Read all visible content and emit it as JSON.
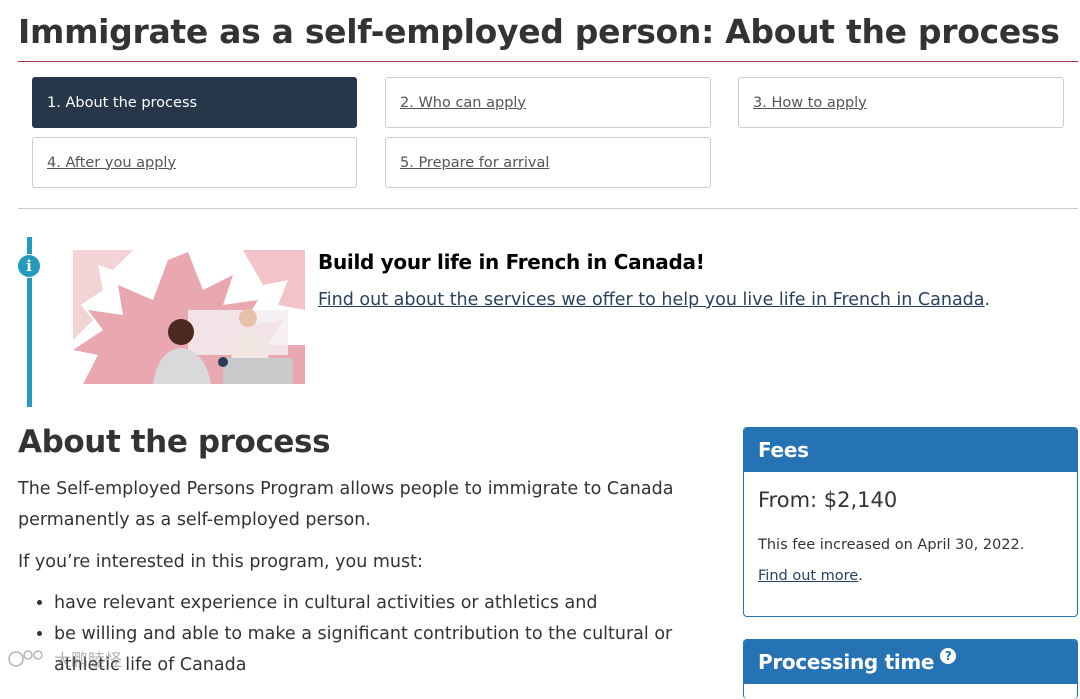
{
  "page": {
    "title": "Immigrate as a self-employed person: About the process"
  },
  "steps": [
    {
      "label": "1. About the process",
      "active": true
    },
    {
      "label": "2. Who can apply",
      "active": false
    },
    {
      "label": "3. How to apply",
      "active": false
    },
    {
      "label": "4. After you apply",
      "active": false
    },
    {
      "label": "5. Prepare for arrival",
      "active": false
    }
  ],
  "notice": {
    "icon": "info-icon",
    "title": "Build your life in French in Canada!",
    "link_text": "Find out about the services we offer to help you live life in French in Canada",
    "link_suffix": "."
  },
  "main": {
    "heading": "About the process",
    "intro": "The Self-employed Persons Program allows people to immigrate to Canada permanently as a self-employed person.",
    "requirements_lead": "If you’re interested in this program, you must:",
    "requirements": [
      "have relevant experience in cultural activities or athletics and",
      "be willing and able to make a significant contribution to the cultural or athletic life of Canada"
    ]
  },
  "fees": {
    "heading": "Fees",
    "amount": "From: $2,140",
    "note": "This fee increased on April 30, 2022.",
    "link_text": "Find out more",
    "link_suffix": "."
  },
  "processing": {
    "heading": "Processing time",
    "help_icon": "question-circle-icon"
  },
  "watermark": {
    "text": "大鹏睦怪"
  },
  "colors": {
    "active_step": "#26374a",
    "title_rule": "#af3c43",
    "panel_blue": "#2572b4",
    "info_blue": "#269abc",
    "link": "#284162"
  }
}
